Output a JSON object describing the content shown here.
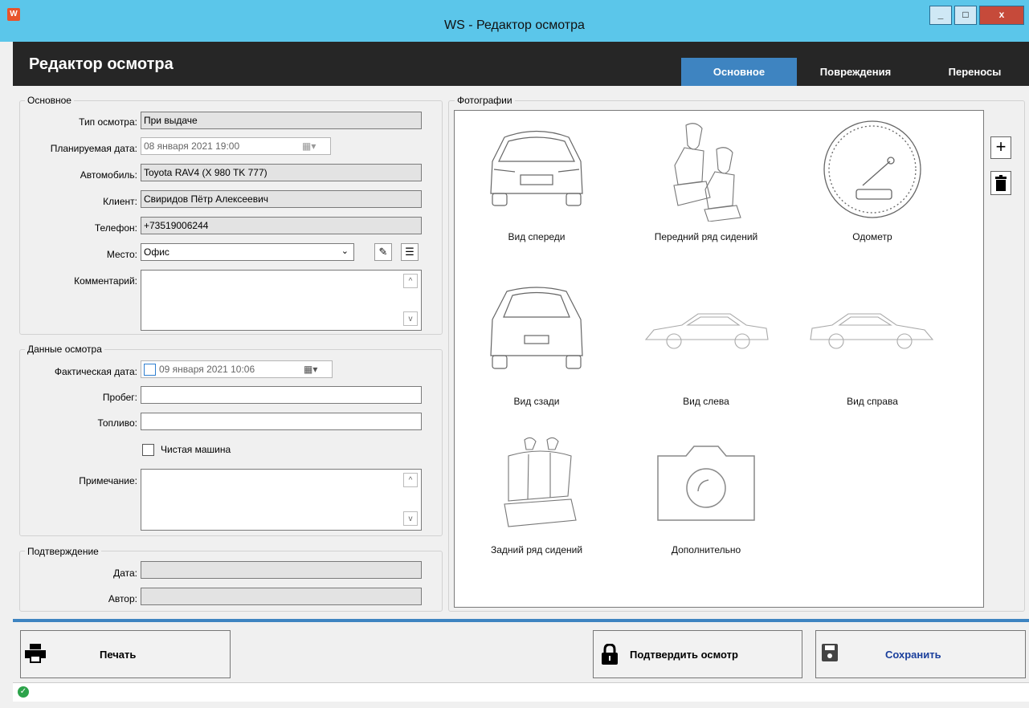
{
  "window": {
    "title": "WS - Редактор осмотра",
    "app_icon": "W",
    "minimize": "_",
    "maximize": "□",
    "close": "x"
  },
  "header": {
    "title": "Редактор осмотра",
    "tabs": [
      {
        "label": "Основное",
        "active": true
      },
      {
        "label": "Повреждения",
        "active": false
      },
      {
        "label": "Переносы",
        "active": false
      }
    ]
  },
  "main_group": {
    "title": "Основное",
    "inspection_type": {
      "label": "Тип осмотра:",
      "value": "При выдаче"
    },
    "planned_date": {
      "label": "Планируемая дата:",
      "value": "08  января   2021 19:00"
    },
    "car": {
      "label": "Автомобиль:",
      "value": "Toyota RAV4 (X 980 TK 777)"
    },
    "client": {
      "label": "Клиент:",
      "value": "Свиридов Пётр Алексеевич"
    },
    "phone": {
      "label": "Телефон:",
      "value": "+73519006244"
    },
    "place": {
      "label": "Место:",
      "value": "Офис"
    },
    "comment": {
      "label": "Комментарий:",
      "value": ""
    }
  },
  "inspection_group": {
    "title": "Данные осмотра",
    "actual_date": {
      "label": "Фактическая дата:",
      "value": "09  января   2021 10:06",
      "checked": false
    },
    "mileage": {
      "label": "Пробег:",
      "value": ""
    },
    "fuel": {
      "label": "Топливо:",
      "value": ""
    },
    "clean_car": {
      "label": "Чистая машина",
      "checked": false
    },
    "note": {
      "label": "Примечание:",
      "value": ""
    }
  },
  "confirm_group": {
    "title": "Подтверждение",
    "date": {
      "label": "Дата:",
      "value": ""
    },
    "author": {
      "label": "Автор:",
      "value": ""
    }
  },
  "photos": {
    "title": "Фотографии",
    "items": [
      {
        "caption": "Вид спереди",
        "icon": "car-front-icon"
      },
      {
        "caption": "Передний ряд сидений",
        "icon": "front-seats-icon"
      },
      {
        "caption": "Одометр",
        "icon": "odometer-icon"
      },
      {
        "caption": "Вид сзади",
        "icon": "car-rear-icon"
      },
      {
        "caption": "Вид слева",
        "icon": "car-left-icon"
      },
      {
        "caption": "Вид справа",
        "icon": "car-right-icon"
      },
      {
        "caption": "Задний ряд сидений",
        "icon": "rear-seats-icon"
      },
      {
        "caption": "Дополнительно",
        "icon": "camera-icon"
      }
    ],
    "add_glyph": "+"
  },
  "footer": {
    "print": "Печать",
    "confirm": "Подтвердить осмотр",
    "save": "Сохранить"
  },
  "colors": {
    "titlebar": "#5bc6ea",
    "header": "#262626",
    "accent": "#3e84c1",
    "save_text": "#1a3f9c"
  }
}
